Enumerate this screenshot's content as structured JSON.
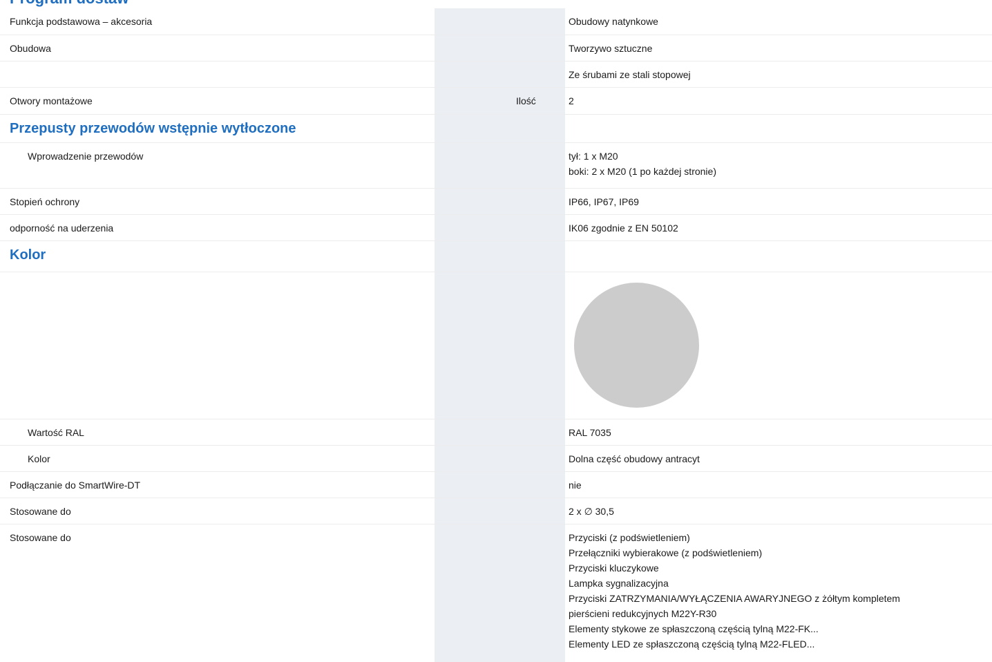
{
  "page": {
    "heading": "Program dostaw",
    "colors": {
      "accent": "#1f6ebf",
      "shaded_column": "#ebeef2",
      "swatch": "#cccccc"
    }
  },
  "rows": {
    "r1": {
      "label": "Funkcja podstawowa – akcesoria",
      "value": "Obudowy natynkowe"
    },
    "r2": {
      "label": "Obudowa",
      "value": "Tworzywo sztuczne"
    },
    "r3": {
      "label": "",
      "value": "Ze śrubami ze stali stopowej"
    },
    "r4": {
      "label": "Otwory montażowe",
      "unit": "Ilość",
      "value": "2"
    },
    "r5": {
      "label": "Przepusty przewodów wstępnie wytłoczone"
    },
    "r6": {
      "label": "Wprowadzenie przewodów",
      "value_lines": [
        "tył: 1 x M20",
        "boki: 2 x M20 (1 po każdej stronie)"
      ]
    },
    "r7": {
      "label": "Stopień ochrony",
      "value": "IP66, IP67, IP69"
    },
    "r8": {
      "label": "odporność na uderzenia",
      "value": "IK06 zgodnie z EN 50102"
    },
    "r9": {
      "label": "Kolor"
    },
    "r10": {
      "swatch_color": "#cccccc"
    },
    "r11": {
      "label": "Wartość RAL",
      "value": "RAL 7035"
    },
    "r12": {
      "label": "Kolor",
      "value": "Dolna część obudowy antracyt"
    },
    "r13": {
      "label": "Podłączanie do SmartWire-DT",
      "value": "nie"
    },
    "r14": {
      "label": "Stosowane do",
      "value": "2 x ∅ 30,5"
    },
    "r15": {
      "label": "Stosowane do",
      "value_lines": [
        "Przyciski (z podświetleniem)",
        "Przełączniki wybierakowe (z podświetleniem)",
        "Przyciski kluczykowe",
        "Lampka sygnalizacyjna",
        "Przyciski ZATRZYMANIA/WYŁĄCZENIA AWARYJNEGO z żółtym kompletem",
        "pierścieni redukcyjnych M22Y-R30",
        "Elementy stykowe ze spłaszczoną częścią tylną M22-FK...",
        "Elementy LED ze spłaszczoną częścią tylną M22-FLED..."
      ]
    }
  }
}
